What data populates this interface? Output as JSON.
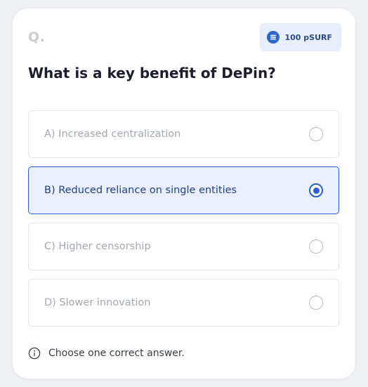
{
  "card": {
    "question_marker": "Q.",
    "reward": {
      "amount_label": "100 pSURF",
      "icon": "coin-icon"
    },
    "question": "What is a key benefit of DePin?",
    "options": [
      {
        "label": "A) Increased centralization",
        "selected": false
      },
      {
        "label": "B) Reduced reliance on single entities",
        "selected": true
      },
      {
        "label": "C) Higher censorship",
        "selected": false
      },
      {
        "label": "D) Slower innovation",
        "selected": false
      }
    ],
    "hint": {
      "icon": "info-icon",
      "text": "Choose one correct answer."
    }
  },
  "colors": {
    "accent": "#2b5fc9",
    "selected_bg": "#e9effc",
    "option_border": "#e4e6eb",
    "muted_text": "#a3a7b0"
  }
}
